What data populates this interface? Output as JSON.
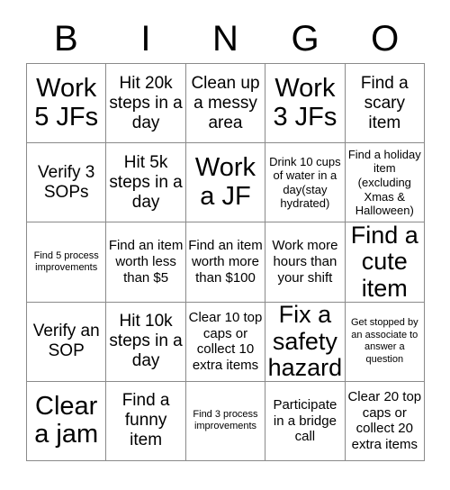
{
  "card": {
    "title": "BINGO",
    "header_letters": [
      "B",
      "I",
      "N",
      "G",
      "O"
    ],
    "grid_size": "5x5",
    "colors": {
      "background": "#ffffff",
      "text": "#000000",
      "grid_line": "#8a8a8a"
    },
    "rows": [
      [
        {
          "text": "Work 5 JFs",
          "size": "xl"
        },
        {
          "text": "Hit 20k steps in a day",
          "size": "md"
        },
        {
          "text": "Clean up a messy area",
          "size": "md"
        },
        {
          "text": "Work 3 JFs",
          "size": "xl"
        },
        {
          "text": "Find a scary item",
          "size": "md"
        }
      ],
      [
        {
          "text": "Verify 3 SOPs",
          "size": "md"
        },
        {
          "text": "Hit 5k steps in a day",
          "size": "md"
        },
        {
          "text": "Work a JF",
          "size": "xl"
        },
        {
          "text": "Drink 10 cups of water in a day(stay hydrated)",
          "size": "xs"
        },
        {
          "text": "Find a holiday item (excluding Xmas & Halloween)",
          "size": "xs"
        }
      ],
      [
        {
          "text": "Find 5 process improvements",
          "size": "xxs"
        },
        {
          "text": "Find an item worth less than $5",
          "size": "sm"
        },
        {
          "text": "Find an item worth more than $100",
          "size": "sm"
        },
        {
          "text": "Work more hours than your shift",
          "size": "sm"
        },
        {
          "text": "Find a cute item",
          "size": "lg"
        }
      ],
      [
        {
          "text": "Verify an SOP",
          "size": "md"
        },
        {
          "text": "Hit 10k steps in a day",
          "size": "md"
        },
        {
          "text": "Clear 10 top caps or collect 10 extra items",
          "size": "sm"
        },
        {
          "text": "Fix a safety hazard",
          "size": "lg"
        },
        {
          "text": "Get stopped by an associate to answer a question",
          "size": "xxs"
        }
      ],
      [
        {
          "text": "Clear a jam",
          "size": "xl"
        },
        {
          "text": "Find a funny item",
          "size": "md"
        },
        {
          "text": "Find 3 process improvements",
          "size": "xxs"
        },
        {
          "text": "Participate in a bridge call",
          "size": "sm"
        },
        {
          "text": "Clear 20 top caps or collect 20 extra items",
          "size": "sm"
        }
      ]
    ]
  }
}
